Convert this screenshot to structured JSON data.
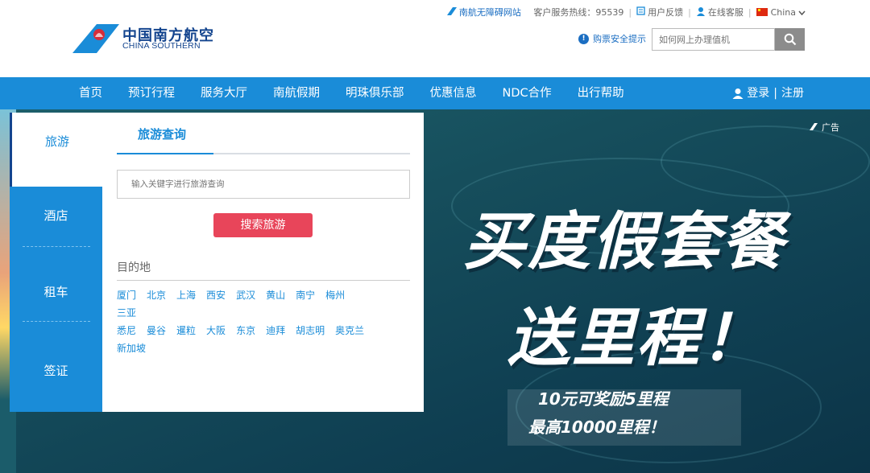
{
  "logo": {
    "name_cn": "中国南方航空",
    "name_en": "CHINA SOUTHERN"
  },
  "topbar": {
    "accessible_site": "南航无障碍网站",
    "hotline": "客户服务热线：95539",
    "feedback": "用户反馈",
    "online_service": "在线客服",
    "region": "China"
  },
  "safety_tip": "购票安全提示",
  "site_search": {
    "placeholder": "如何网上办理值机"
  },
  "nav": {
    "items": [
      "首页",
      "预订行程",
      "服务大厅",
      "南航假期",
      "明珠俱乐部",
      "优惠信息",
      "NDC合作",
      "出行帮助"
    ],
    "login": "登录",
    "register": "注册"
  },
  "side_tabs": [
    "旅游",
    "酒店",
    "租车",
    "签证"
  ],
  "form": {
    "tab_label": "旅游查询",
    "keyword_placeholder": "输入关键字进行旅游查询",
    "search_button": "搜索旅游",
    "destinations_title": "目的地",
    "destinations": [
      "厦门",
      "北京",
      "上海",
      "西安",
      "武汉",
      "黄山",
      "南宁",
      "梅州",
      "三亚",
      "悉尼",
      "曼谷",
      "暹粒",
      "大阪",
      "东京",
      "迪拜",
      "胡志明",
      "奥克兰",
      "新加坡"
    ]
  },
  "banner": {
    "ad_tag": "广告",
    "headline_1": "买度假套餐",
    "headline_2": "送里程！",
    "sub_1": "10元可奖励5里程",
    "sub_2": "最高10000里程！"
  },
  "colors": {
    "brand_blue": "#1a8cd8",
    "logo_navy": "#13448e",
    "search_red": "#e8455a",
    "banner_teal": "#164e5c"
  }
}
